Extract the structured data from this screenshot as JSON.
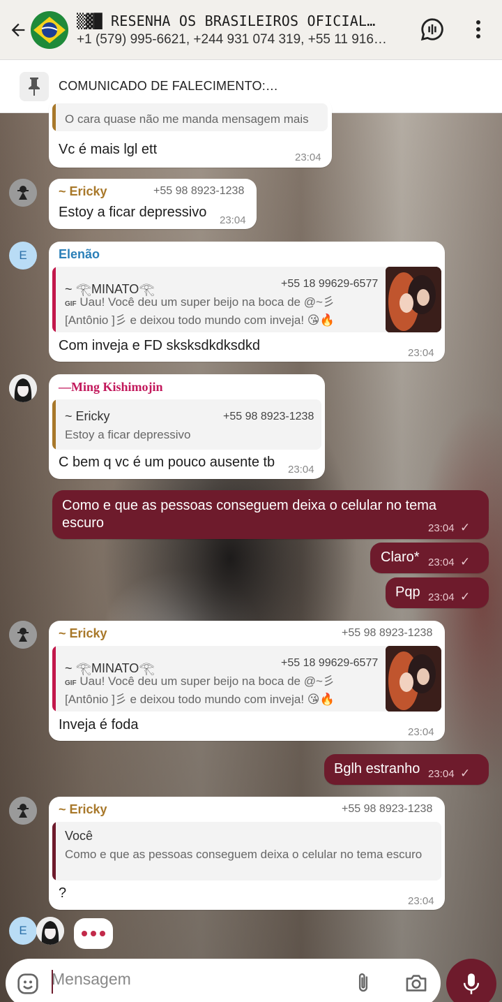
{
  "header": {
    "title": "▒▓█ RESENHA OS BRASILEIROS OFICIAL…",
    "subtitle": "+1 (579) 995-6621, +244 931 074 319, +55 11 916…",
    "back_icon": "back-arrow-icon",
    "call_icon": "group-call-icon",
    "menu_icon": "more-vert-icon"
  },
  "pinned": {
    "text": "COMUNICADO DE FALECIMENTO:…",
    "icon": "pin-icon"
  },
  "messages": [
    {
      "quote_text": "O cara quase não me manda mensagem mais",
      "text": "Vc é mais lgl ett",
      "time": "23:04"
    },
    {
      "sender": "~ Ericky",
      "phone": "+55 98 8923-1238",
      "text": "Estoy a ficar depressivo",
      "time": "23:04"
    },
    {
      "avatar_letter": "E",
      "sender": "Elenão",
      "quote_name": "~ 𓂀MINATO𓂀",
      "quote_phone": "+55 18 99629-6577",
      "quote_line1": "Uau! Você deu um super beijo na boca de @~彡",
      "quote_line2": "[Antônio ]彡 e deixou todo mundo com inveja! 😘🔥",
      "gif_label": "GIF",
      "text": "Com inveja e FD sksksdkdksdkd",
      "time": "23:04"
    },
    {
      "sender": "—Ming Kishimojin",
      "quote_name": "~ Ericky",
      "quote_phone": "+55 98 8923-1238",
      "quote_text": "Estoy a ficar depressivo",
      "text": "C bem q vc é um pouco ausente tb",
      "time": "23:04"
    },
    {
      "text": "Como e que as pessoas conseguem deixa o celular no tema escuro",
      "time": "23:04"
    },
    {
      "text": "Claro*",
      "time": "23:04"
    },
    {
      "text": "Pqp",
      "time": "23:04"
    },
    {
      "sender": "~ Ericky",
      "phone": "+55 98 8923-1238",
      "quote_name": "~ 𓂀MINATO𓂀",
      "quote_phone": "+55 18 99629-6577",
      "quote_line1": "Uau! Você deu um super beijo na boca de @~彡",
      "quote_line2": "[Antônio ]彡 e deixou todo mundo com inveja! 😘🔥",
      "gif_label": "GIF",
      "text": "Inveja é foda",
      "time": "23:04"
    },
    {
      "text": "Bglh estranho",
      "time": "23:04"
    },
    {
      "sender": "~ Ericky",
      "phone": "+55 98 8923-1238",
      "quote_name": "Você",
      "quote_text": "Como e que as pessoas conseguem deixa o celular no tema escuro",
      "text": "?",
      "time": "23:04"
    }
  ],
  "typing_avatar_letter": "E",
  "composer": {
    "placeholder": "Mensagem",
    "emoji_icon": "emoji-icon",
    "attach_icon": "paperclip-icon",
    "camera_icon": "camera-icon",
    "mic_icon": "microphone-icon"
  },
  "colors": {
    "accent": "#6e1b2c",
    "sender_ericky": "#a8782a",
    "sender_elenao": "#2a7fb8",
    "sender_ming": "#c2185b",
    "quote_bar_red": "#c2184b",
    "quote_bar_gold": "#a8782a",
    "quote_bar_maroon": "#6e1b2c"
  }
}
